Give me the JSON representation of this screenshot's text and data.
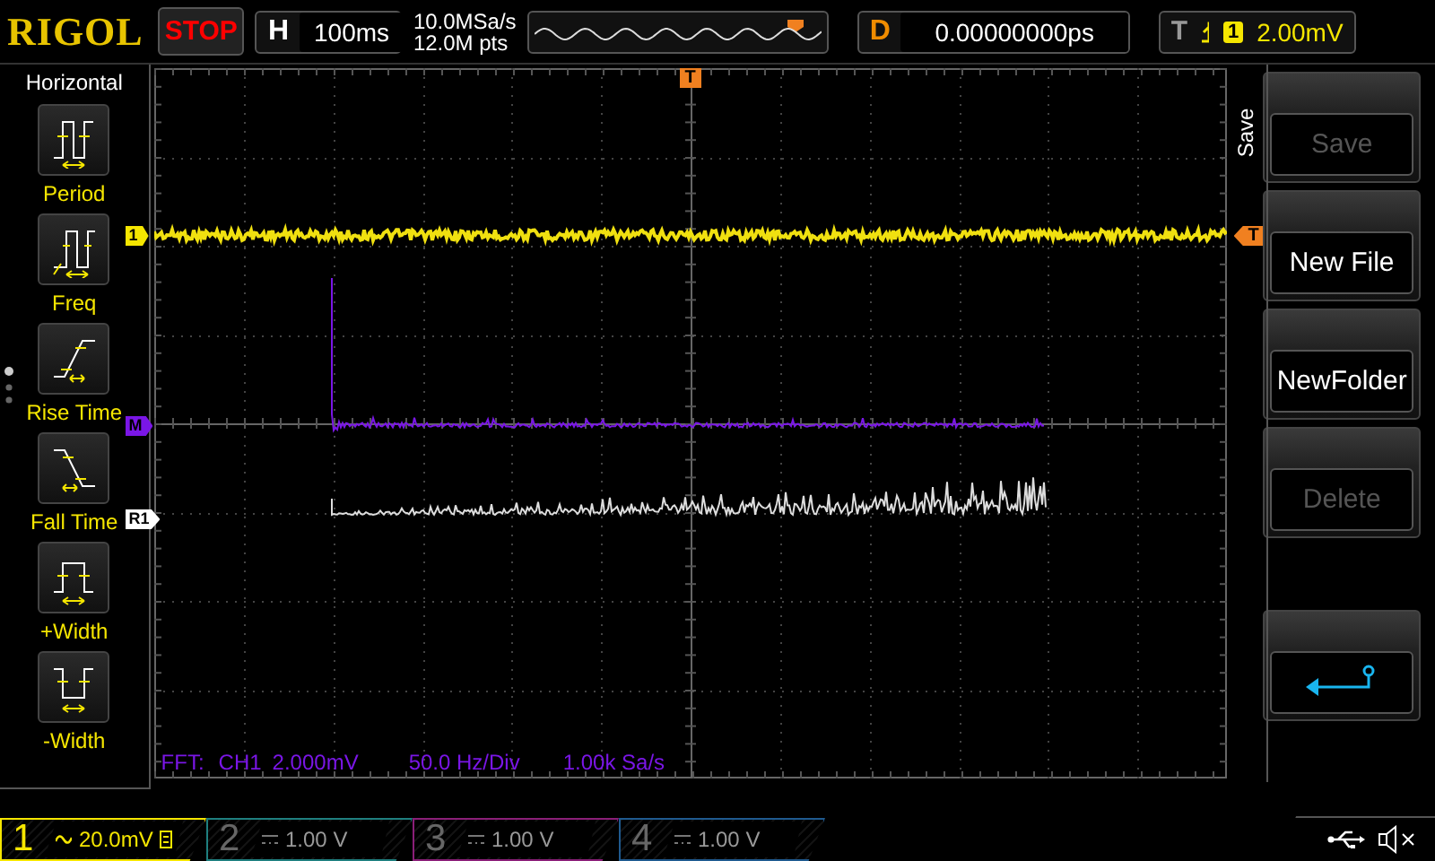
{
  "logo": "RIGOL",
  "run_state": "STOP",
  "horizontal": {
    "label": "H",
    "value": "100ms"
  },
  "sample_rate": "10.0MSa/s",
  "memory_depth": "12.0M pts",
  "delay": {
    "label": "D",
    "value": "0.00000000ps"
  },
  "trigger": {
    "label": "T",
    "source": "1",
    "level": "2.00mV"
  },
  "left_menu": {
    "title": "Horizontal",
    "items": [
      {
        "label": "Period",
        "kind": "period"
      },
      {
        "label": "Freq",
        "kind": "freq"
      },
      {
        "label": "Rise Time",
        "kind": "rise"
      },
      {
        "label": "Fall Time",
        "kind": "fall"
      },
      {
        "label": "+Width",
        "kind": "pwidth"
      },
      {
        "label": "-Width",
        "kind": "nwidth"
      }
    ]
  },
  "grid": {
    "markers": [
      {
        "label": "1",
        "kind": "channel"
      },
      {
        "label": "M",
        "kind": "math"
      },
      {
        "label": "R1",
        "kind": "ref"
      }
    ],
    "trigger_position_marker": "T",
    "trigger_level_marker": "T",
    "fft_info": [
      "FFT:",
      "CH1",
      "2.000mV",
      "50.0 Hz/Div",
      "1.00k Sa/s"
    ]
  },
  "right_menu": {
    "title": "Save",
    "buttons": [
      {
        "kind": "text",
        "label": "Save",
        "disabled": true
      },
      {
        "kind": "text",
        "label": "New File",
        "disabled": false
      },
      {
        "kind": "text",
        "label": "NewFolder",
        "disabled": false
      },
      {
        "kind": "text",
        "label": "Delete",
        "disabled": true
      },
      {
        "kind": "back"
      }
    ]
  },
  "channels": [
    {
      "number": "1",
      "ac_coupled": true,
      "scale": "20.0mV",
      "on": true,
      "bw_limit": true,
      "color": "#f5e600"
    },
    {
      "number": "2",
      "ac_coupled": false,
      "scale": "1.00 V",
      "on": false,
      "bw_limit": false,
      "color": "#1f7f7f"
    },
    {
      "number": "3",
      "ac_coupled": false,
      "scale": "1.00 V",
      "on": false,
      "bw_limit": false,
      "color": "#8a1f78"
    },
    {
      "number": "4",
      "ac_coupled": false,
      "scale": "1.00 V",
      "on": false,
      "bw_limit": false,
      "color": "#1f5a8f"
    }
  ]
}
